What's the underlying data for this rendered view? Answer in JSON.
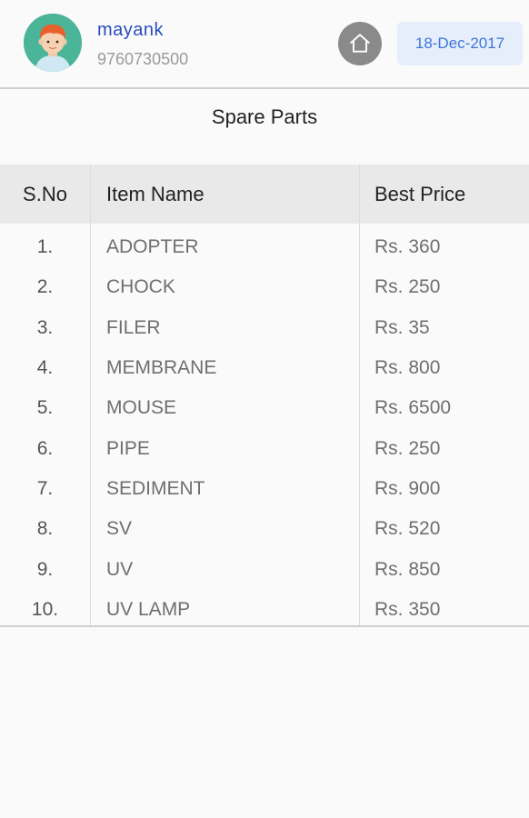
{
  "header": {
    "user_name": "mayank",
    "user_phone": "9760730500",
    "date": "18-Dec-2017"
  },
  "page_title": "Spare Parts",
  "table": {
    "columns": [
      "S.No",
      "Item Name",
      "Best Price"
    ],
    "rows": [
      {
        "sno": "1.",
        "name": "ADOPTER",
        "price": "Rs. 360"
      },
      {
        "sno": "2.",
        "name": "CHOCK",
        "price": "Rs. 250"
      },
      {
        "sno": "3.",
        "name": "FILER",
        "price": "Rs. 35"
      },
      {
        "sno": "4.",
        "name": "MEMBRANE",
        "price": "Rs. 800"
      },
      {
        "sno": "5.",
        "name": "MOUSE",
        "price": "Rs. 6500"
      },
      {
        "sno": "6.",
        "name": "PIPE",
        "price": "Rs. 250"
      },
      {
        "sno": "7.",
        "name": "SEDIMENT",
        "price": "Rs. 900"
      },
      {
        "sno": "8.",
        "name": "SV",
        "price": "Rs. 520"
      },
      {
        "sno": "9.",
        "name": "UV",
        "price": "Rs. 850"
      },
      {
        "sno": "10.",
        "name": "UV LAMP",
        "price": "Rs. 350"
      }
    ]
  },
  "icons": {
    "avatar": "user-avatar-icon",
    "home": "home-icon"
  },
  "colors": {
    "avatar_bg": "#4bb59a",
    "user_name": "#2b4cbf",
    "date_text": "#3b77d6",
    "date_bg": "#e7eefb",
    "home_btn": "#8a8a8a",
    "header_row_bg": "#e9e9e9"
  }
}
